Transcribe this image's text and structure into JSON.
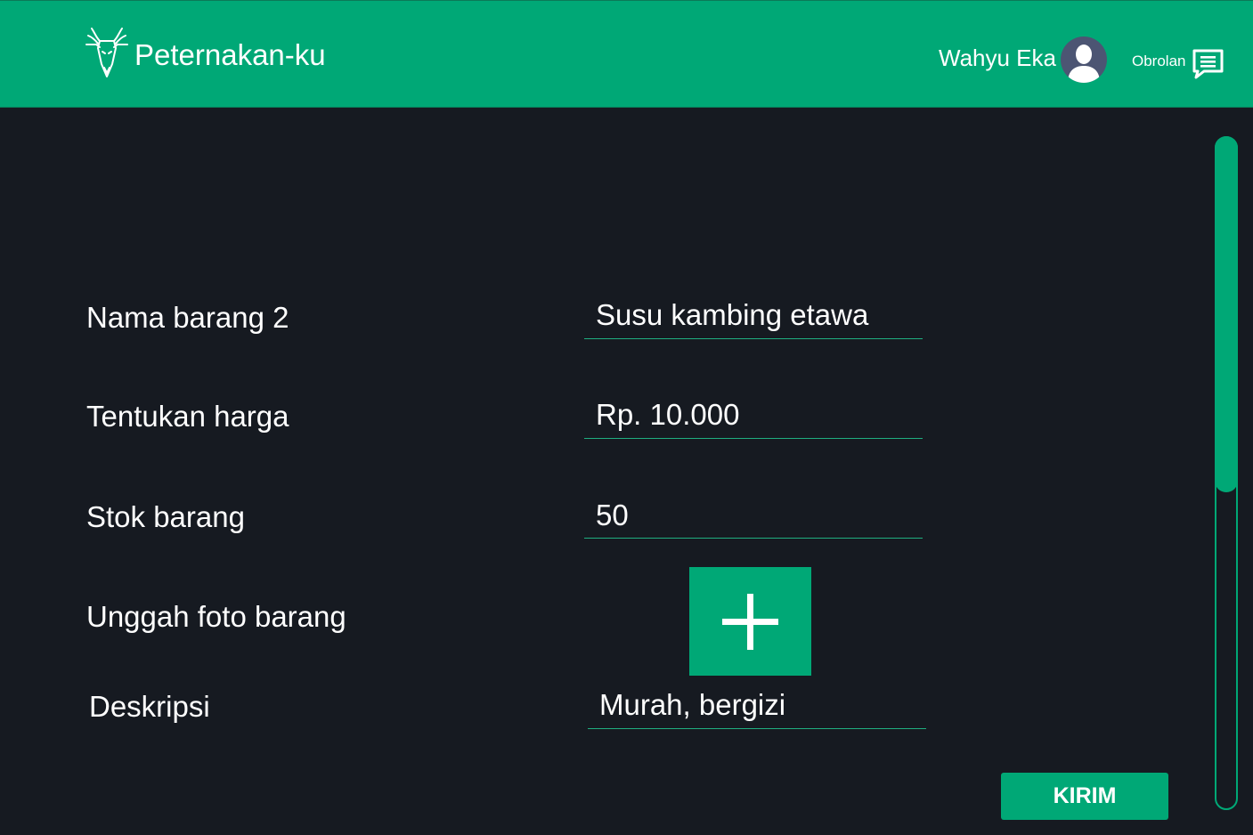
{
  "header": {
    "app_title": "Peternakan-ku",
    "logo_icon": "goat-head-icon",
    "user_name": "Wahyu Eka",
    "avatar_icon": "user-avatar-icon",
    "chat_label": "Obrolan",
    "chat_icon": "chat-bubble-icon"
  },
  "form": {
    "fields": [
      {
        "label": "Nama barang 2",
        "value": "Susu kambing etawa"
      },
      {
        "label": "Tentukan harga",
        "value": "Rp. 10.000"
      },
      {
        "label": "Stok barang",
        "value": "50"
      },
      {
        "label": "Unggah foto barang",
        "upload_icon": "plus-icon"
      },
      {
        "label": "Deskripsi",
        "value": "Murah, bergizi"
      }
    ],
    "submit_label": "KIRIM"
  },
  "scrollbar": {
    "position_fraction": 0.0,
    "visible_fraction": 0.53
  },
  "colors": {
    "accent": "#00a876",
    "background": "#161a21",
    "text": "#ffffff"
  }
}
